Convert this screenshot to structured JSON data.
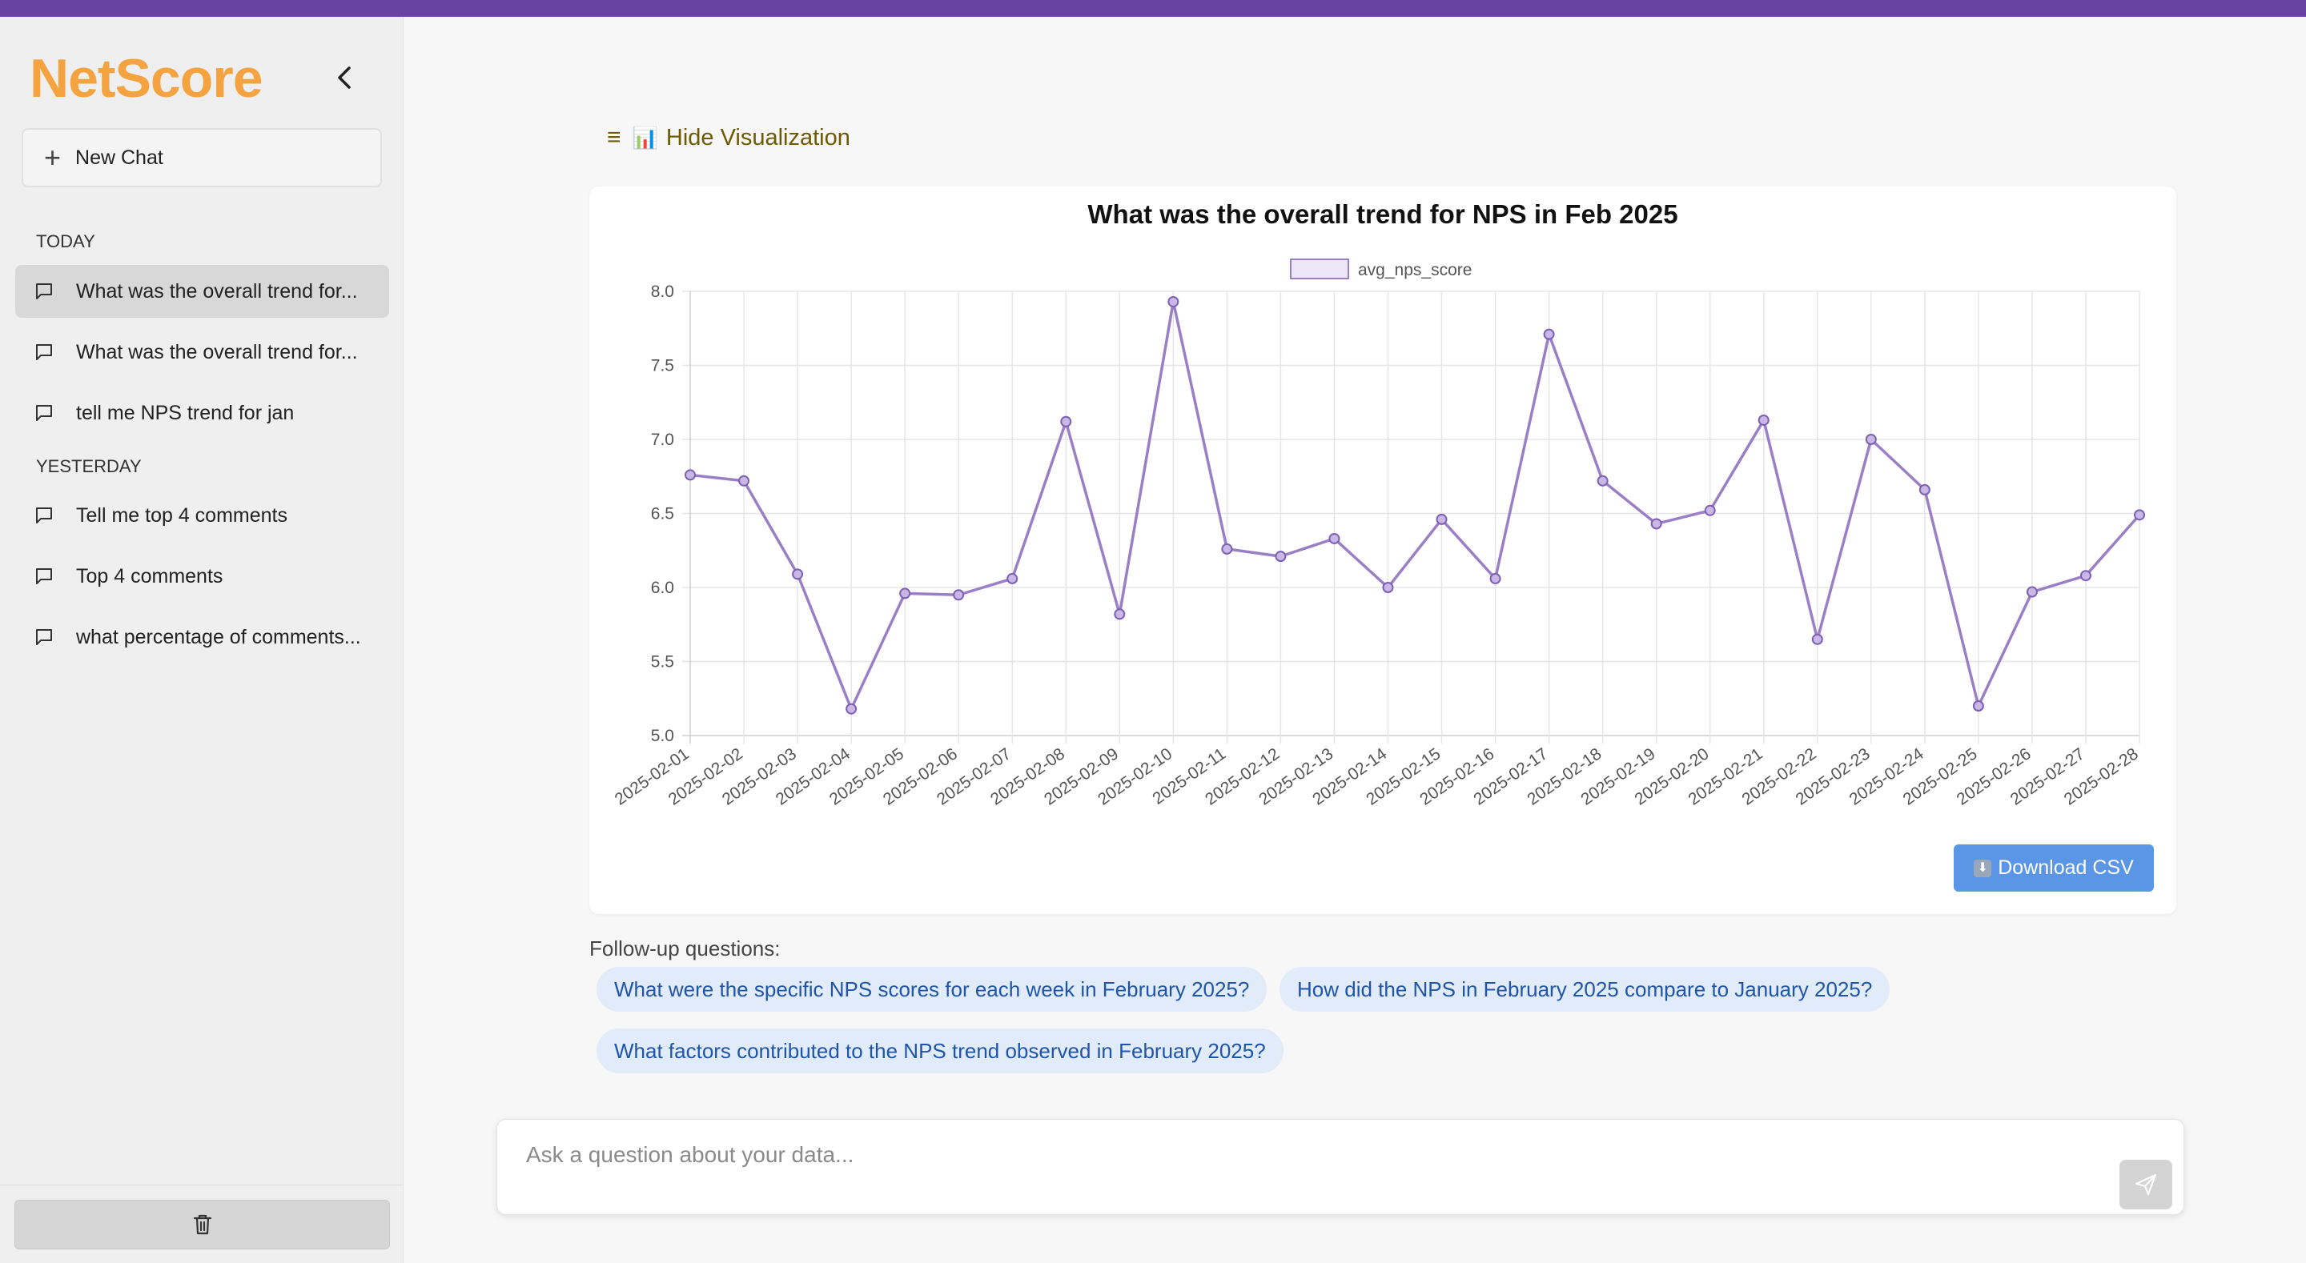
{
  "app": {
    "logo": "NetScore"
  },
  "sidebar": {
    "new_chat_label": "New Chat",
    "sections": [
      {
        "label": "TODAY",
        "items": [
          {
            "label": "What was the overall trend for...",
            "active": true
          },
          {
            "label": "What was the overall trend for...",
            "active": false
          },
          {
            "label": "tell me NPS trend for jan",
            "active": false
          }
        ]
      },
      {
        "label": "YESTERDAY",
        "items": [
          {
            "label": "Tell me top 4 comments",
            "active": false
          },
          {
            "label": "Top 4 comments",
            "active": false
          },
          {
            "label": "what percentage of comments...",
            "active": false
          }
        ]
      }
    ]
  },
  "main": {
    "toggle_viz_icon": "📊",
    "toggle_viz_label": "Hide Visualization",
    "download_csv_label": "Download CSV",
    "followup_label": "Follow-up questions:",
    "followups": [
      "What were the specific NPS scores for each week in February 2025?",
      "How did the NPS in February 2025 compare to January 2025?",
      "What factors contributed to the NPS trend observed in February 2025?"
    ],
    "input_placeholder": "Ask a question about your data..."
  },
  "colors": {
    "topbar": "#6a43a0",
    "logo": "#f4a340",
    "series": "#9b7fc6",
    "download_button": "#5b95e6",
    "chip_background": "#e2ebfa",
    "chip_text": "#1f55a8"
  },
  "chart_data": {
    "type": "line",
    "title": "What was the overall trend for NPS in Feb 2025",
    "xlabel": "",
    "ylabel": "",
    "ylim": [
      5.0,
      8.0
    ],
    "yticks": [
      "5.0",
      "5.5",
      "6.0",
      "6.5",
      "7.0",
      "7.5",
      "8.0"
    ],
    "grid": true,
    "legend_position": "top-center",
    "categories": [
      "2025-02-01",
      "2025-02-02",
      "2025-02-03",
      "2025-02-04",
      "2025-02-05",
      "2025-02-06",
      "2025-02-07",
      "2025-02-08",
      "2025-02-09",
      "2025-02-10",
      "2025-02-11",
      "2025-02-12",
      "2025-02-13",
      "2025-02-14",
      "2025-02-15",
      "2025-02-16",
      "2025-02-17",
      "2025-02-18",
      "2025-02-19",
      "2025-02-20",
      "2025-02-21",
      "2025-02-22",
      "2025-02-23",
      "2025-02-24",
      "2025-02-25",
      "2025-02-26",
      "2025-02-27",
      "2025-02-28"
    ],
    "series": [
      {
        "name": "avg_nps_score",
        "color": "#9b7fc6",
        "values": [
          6.76,
          6.72,
          6.09,
          5.18,
          5.96,
          5.95,
          6.06,
          7.12,
          5.82,
          7.93,
          6.26,
          6.21,
          6.33,
          6.0,
          6.46,
          6.06,
          7.71,
          6.72,
          6.43,
          6.52,
          7.13,
          5.65,
          7.0,
          6.66,
          5.2,
          5.97,
          6.08,
          6.49
        ]
      }
    ]
  }
}
